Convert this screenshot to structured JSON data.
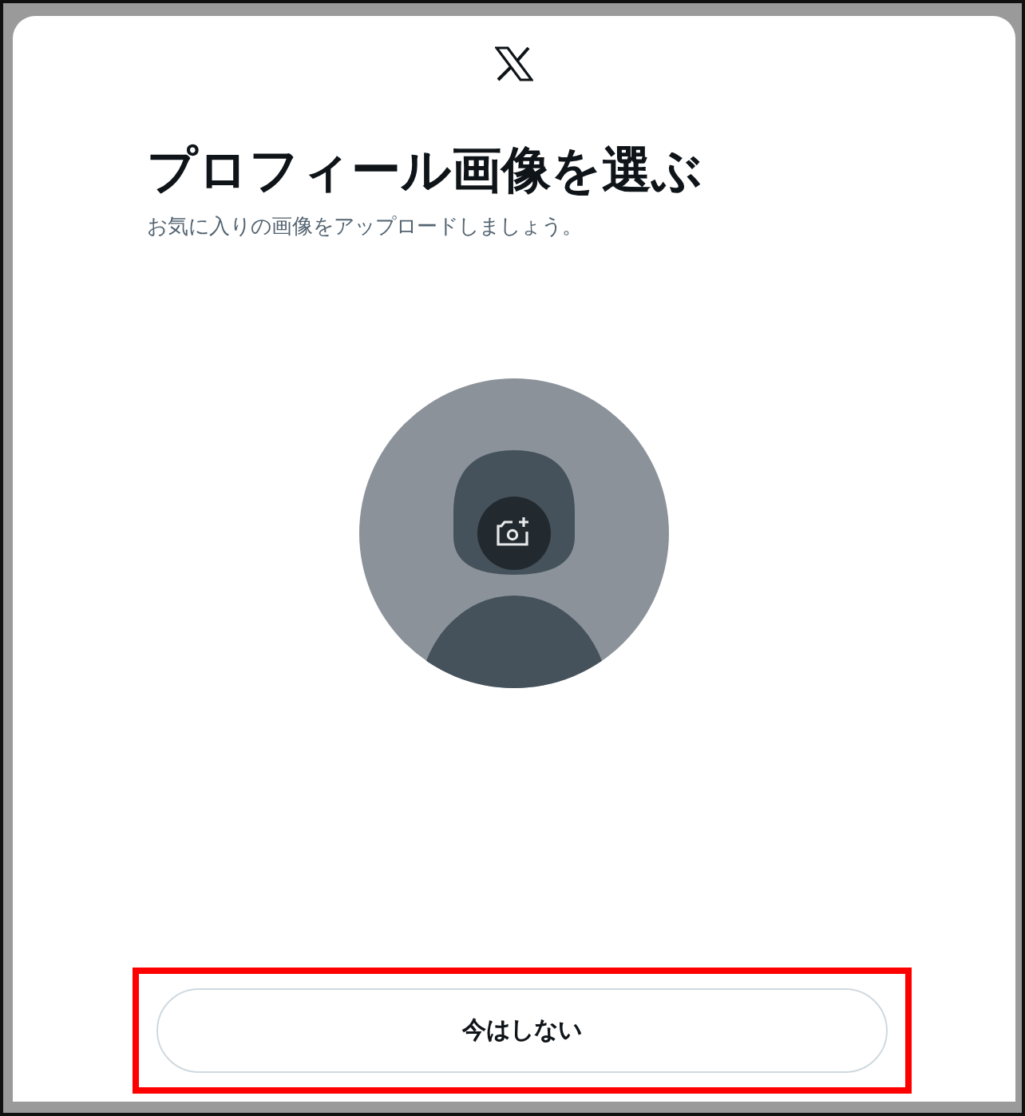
{
  "dialog": {
    "title": "プロフィール画像を選ぶ",
    "subtitle": "お気に入りの画像をアップロードしましょう。"
  },
  "avatar": {
    "kind": "placeholder"
  },
  "buttons": [
    {
      "label": "今はしない",
      "highlighted": true
    }
  ]
}
